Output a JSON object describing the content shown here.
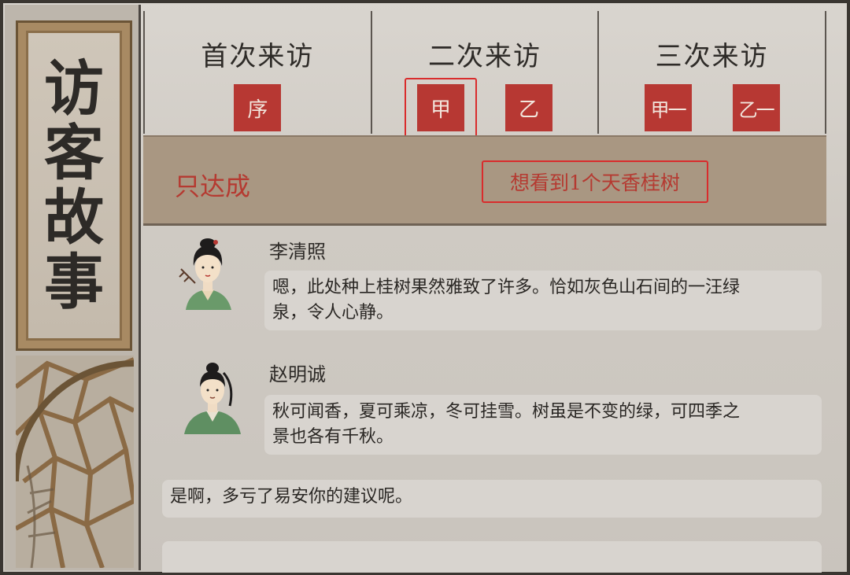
{
  "side": {
    "title_chars": [
      "访",
      "客",
      "故",
      "事"
    ]
  },
  "tabs": [
    {
      "title": "首次来访",
      "seals": [
        "序"
      ]
    },
    {
      "title": "二次来访",
      "seals": [
        "甲",
        "乙"
      ]
    },
    {
      "title": "三次来访",
      "seals": [
        "甲一",
        "乙一"
      ]
    }
  ],
  "selected": {
    "tab": 1,
    "seal": 0
  },
  "condition": {
    "status": "只达成",
    "goal": "想看到1个天香桂树"
  },
  "dialogue": [
    {
      "speaker": "李清照",
      "text_line1": "嗯，此处种上桂树果然雅致了许多。恰如灰色山石间的一汪绿",
      "text_line2": "泉，令人心静。"
    },
    {
      "speaker": "赵明诚",
      "text_line1": "秋可闻香，夏可乘凉，冬可挂雪。树虽是不变的绿，可四季之",
      "text_line2": "景也各有千秋。"
    },
    {
      "speaker": "",
      "text_line1": "是啊，多亏了易安你的建议呢。",
      "text_line2": ""
    }
  ],
  "colors": {
    "seal_red": "#b73833",
    "highlight_red": "#d92c2c",
    "status_red": "#b53a31",
    "condition_bg": "#a99782"
  }
}
